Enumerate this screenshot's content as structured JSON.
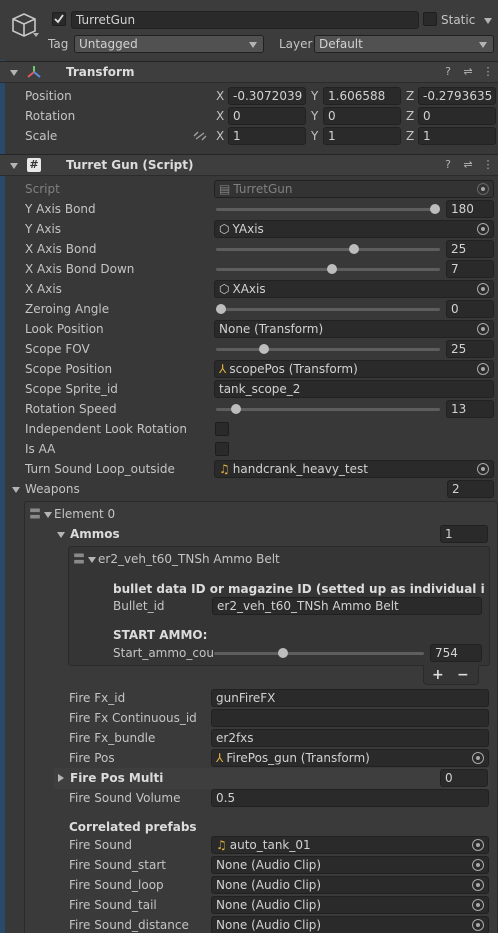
{
  "header": {
    "object_name": "TurretGun",
    "static_label": "Static",
    "tag_label": "Tag",
    "tag_value": "Untagged",
    "layer_label": "Layer",
    "layer_value": "Default"
  },
  "transform": {
    "title": "Transform",
    "position_label": "Position",
    "rotation_label": "Rotation",
    "scale_label": "Scale",
    "axis_x": "X",
    "axis_y": "Y",
    "axis_z": "Z",
    "position": [
      "-0.3072039",
      "1.606588",
      "-0.2793635"
    ],
    "rotation": [
      "0",
      "0",
      "0"
    ],
    "scale": [
      "1",
      "1",
      "1"
    ]
  },
  "script": {
    "title": "Turret Gun (Script)",
    "script_label": "Script",
    "script_value": "TurretGun",
    "y_axis_bond_label": "Y Axis Bond",
    "y_axis_bond_value": "180",
    "y_axis_label": "Y Axis",
    "y_axis_value": "YAxis",
    "x_axis_bond_label": "X Axis Bond",
    "x_axis_bond_value": "25",
    "x_axis_bond_down_label": "X Axis Bond Down",
    "x_axis_bond_down_value": "7",
    "x_axis_label": "X Axis",
    "x_axis_value": "XAxis",
    "zeroing_angle_label": "Zeroing Angle",
    "zeroing_angle_value": "0",
    "look_position_label": "Look Position",
    "look_position_value": "None (Transform)",
    "scope_fov_label": "Scope FOV",
    "scope_fov_value": "25",
    "scope_position_label": "Scope Position",
    "scope_position_value": "scopePos (Transform)",
    "scope_sprite_label": "Scope Sprite_id",
    "scope_sprite_value": "tank_scope_2",
    "rotation_speed_label": "Rotation Speed",
    "rotation_speed_value": "13",
    "independent_look_label": "Independent Look Rotation",
    "is_aa_label": "Is AA",
    "turn_sound_label": "Turn Sound Loop_outside",
    "turn_sound_value": "handcrank_heavy_test",
    "sliders": {
      "y_axis_bond": 1.0,
      "x_axis_bond": 0.62,
      "x_axis_bond_down": 0.52,
      "zeroing_angle": 0.0,
      "scope_fov": 0.2,
      "rotation_speed": 0.07,
      "start_ammo": 0.32
    }
  },
  "weapons": {
    "label": "Weapons",
    "count": "2",
    "element_label": "Element 0",
    "ammos_label": "Ammos",
    "ammos_count": "1",
    "ammo_item_title": "er2_veh_t60_TNSh Ammo Belt",
    "bullet_header": "bullet data ID or magazine ID (setted up as individual item in the",
    "bullet_id_label": "Bullet_id",
    "bullet_id_value": "er2_veh_t60_TNSh Ammo Belt",
    "start_ammo_header": "START AMMO:",
    "start_ammo_label": "Start_ammo_coun",
    "start_ammo_value": "754",
    "plus": "+",
    "minus": "−",
    "fire_fx_id_label": "Fire Fx_id",
    "fire_fx_id_value": "gunFireFX",
    "fire_fx_cont_label": "Fire Fx Continuous_id",
    "fire_fx_cont_value": "",
    "fire_fx_bundle_label": "Fire Fx_bundle",
    "fire_fx_bundle_value": "er2fxs",
    "fire_pos_label": "Fire Pos",
    "fire_pos_value": "FirePos_gun (Transform)",
    "fire_pos_multi_label": "Fire Pos Multi",
    "fire_pos_multi_value": "0",
    "fire_sound_volume_label": "Fire Sound Volume",
    "fire_sound_volume_value": "0.5",
    "correlated_label": "Correlated prefabs",
    "fire_sound_label": "Fire Sound",
    "fire_sound_value": "auto_tank_01",
    "fire_sound_start_label": "Fire Sound_start",
    "fire_sound_start_value": "None (Audio Clip)",
    "fire_sound_loop_label": "Fire Sound_loop",
    "fire_sound_loop_value": "None (Audio Clip)",
    "fire_sound_tail_label": "Fire Sound_tail",
    "fire_sound_tail_value": "None (Audio Clip)",
    "fire_sound_distance_label": "Fire Sound_distance",
    "fire_sound_distance_value": "None (Audio Clip)"
  }
}
